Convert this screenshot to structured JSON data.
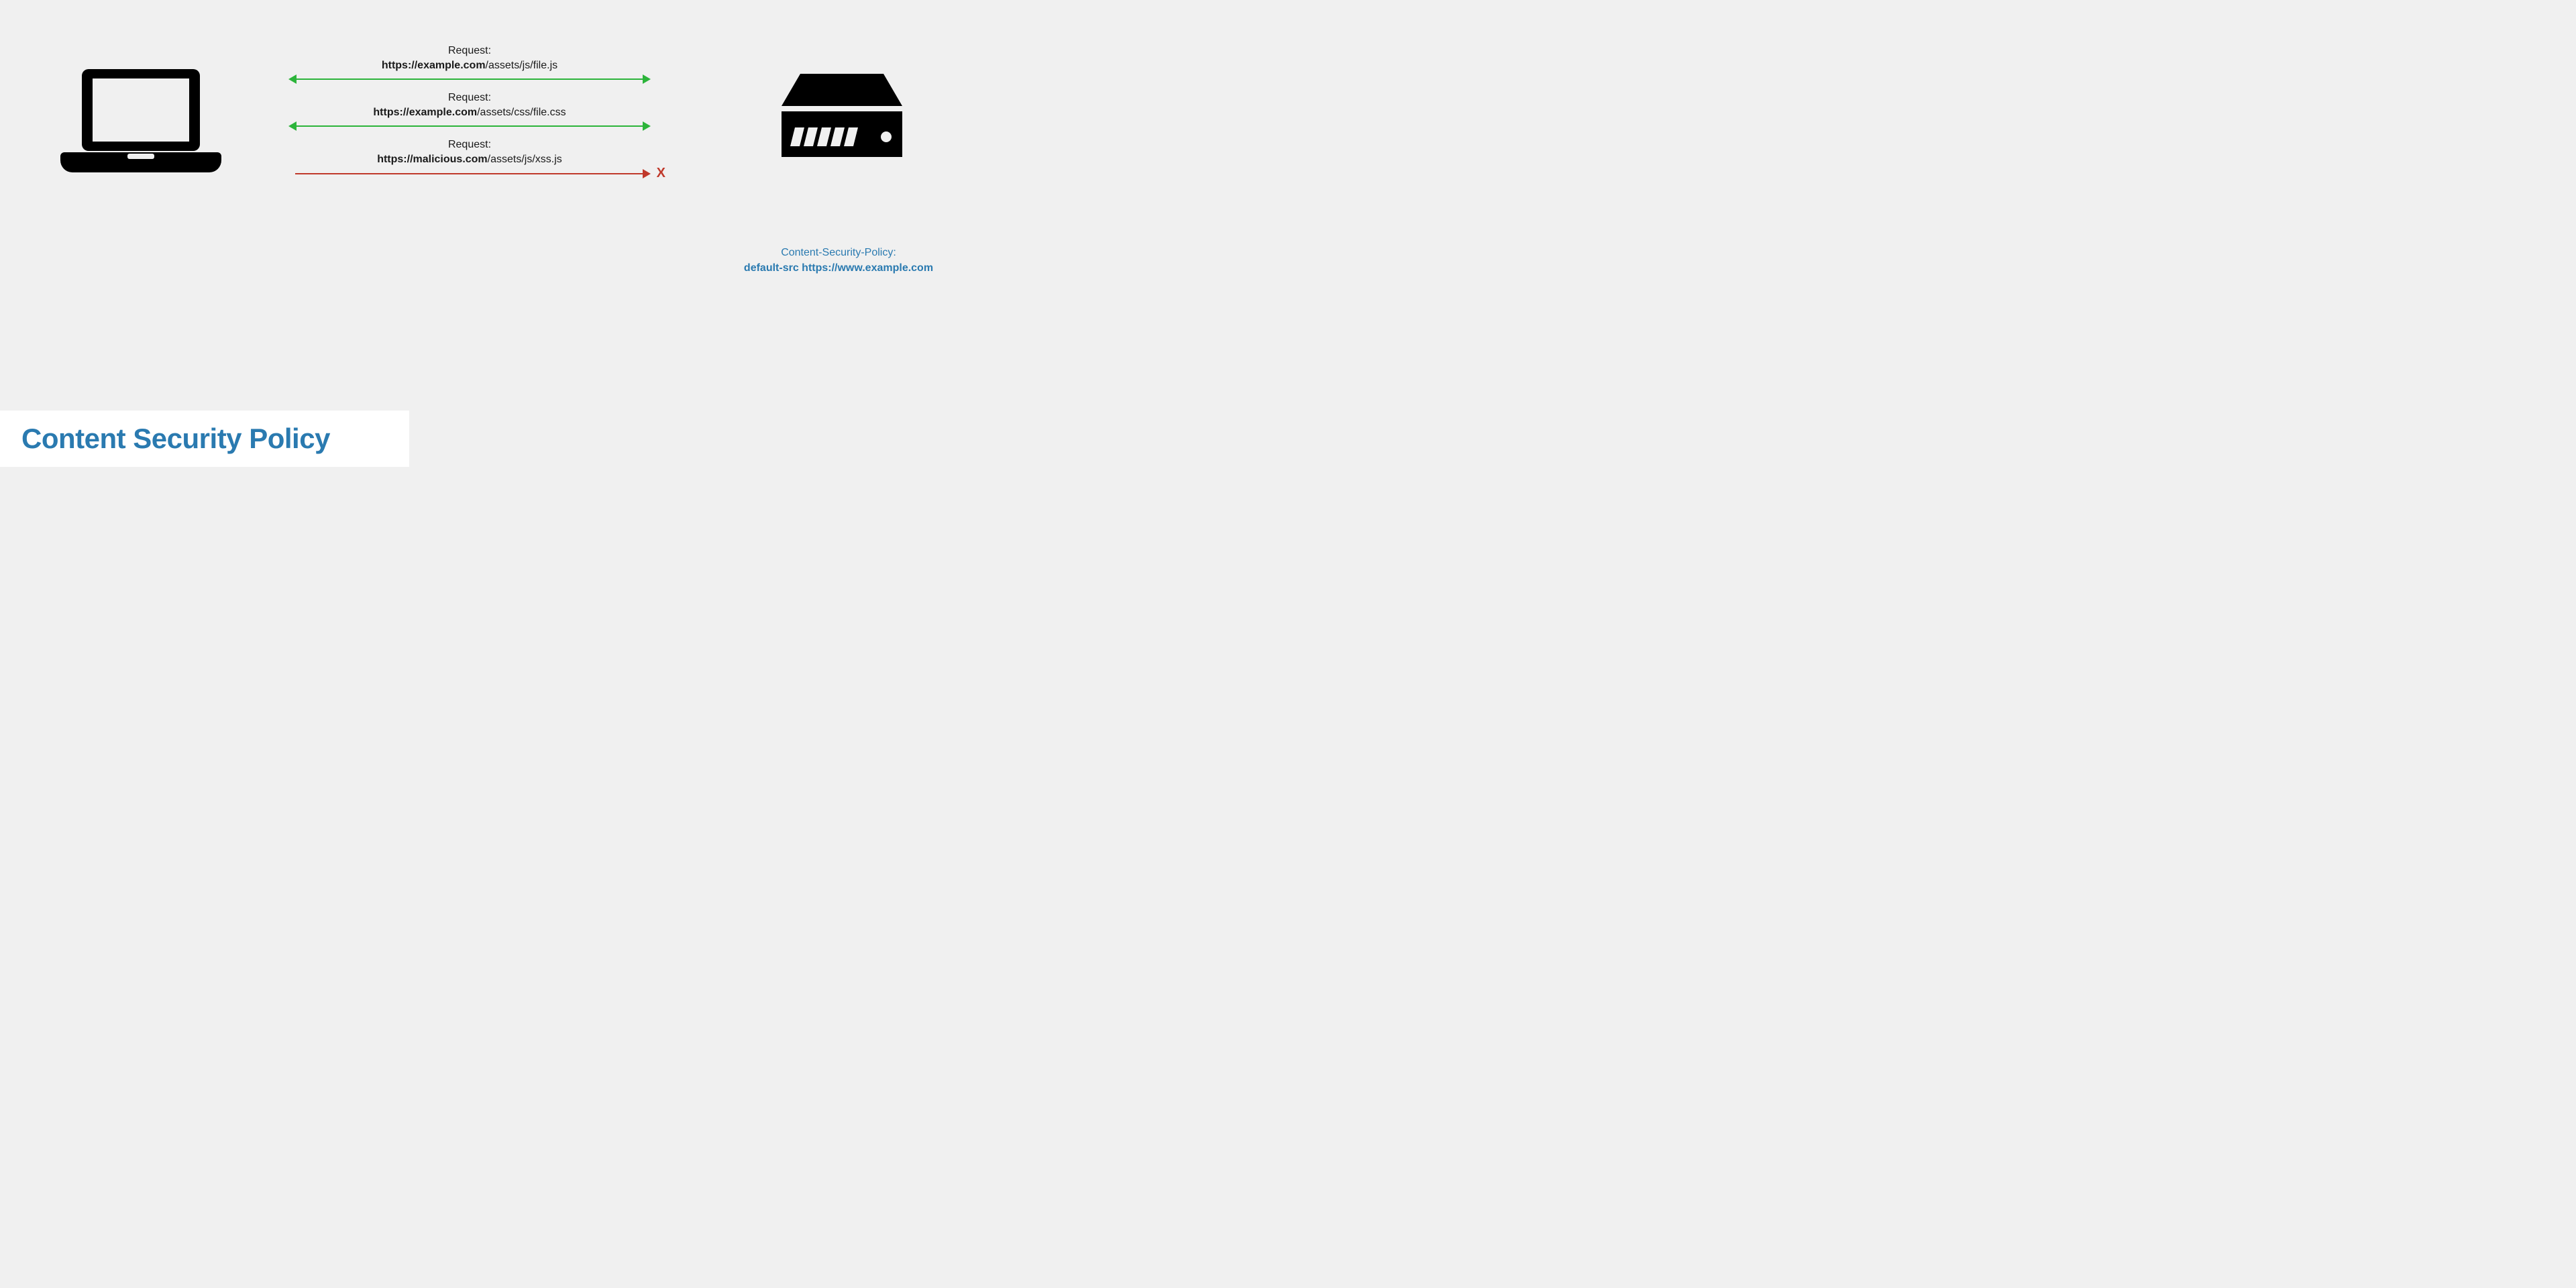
{
  "title": "Content Security Policy",
  "requests": [
    {
      "label": "Request:",
      "url_bold": "https://example.com",
      "url_rest": "/assets/js/file.js",
      "blocked": false
    },
    {
      "label": "Request:",
      "url_bold": "https://example.com",
      "url_rest": "/assets/css/file.css",
      "blocked": false
    },
    {
      "label": "Request:",
      "url_bold": "https://malicious.com",
      "url_rest": "/assets/js/xss.js",
      "blocked": true
    }
  ],
  "blocked_marker": "X",
  "csp_header_label": "Content-Security-Policy:",
  "csp_header_value": "default-src https://www.example.com",
  "colors": {
    "allow": "#2cb43a",
    "block": "#c0392b",
    "accent": "#2a7ab0"
  }
}
